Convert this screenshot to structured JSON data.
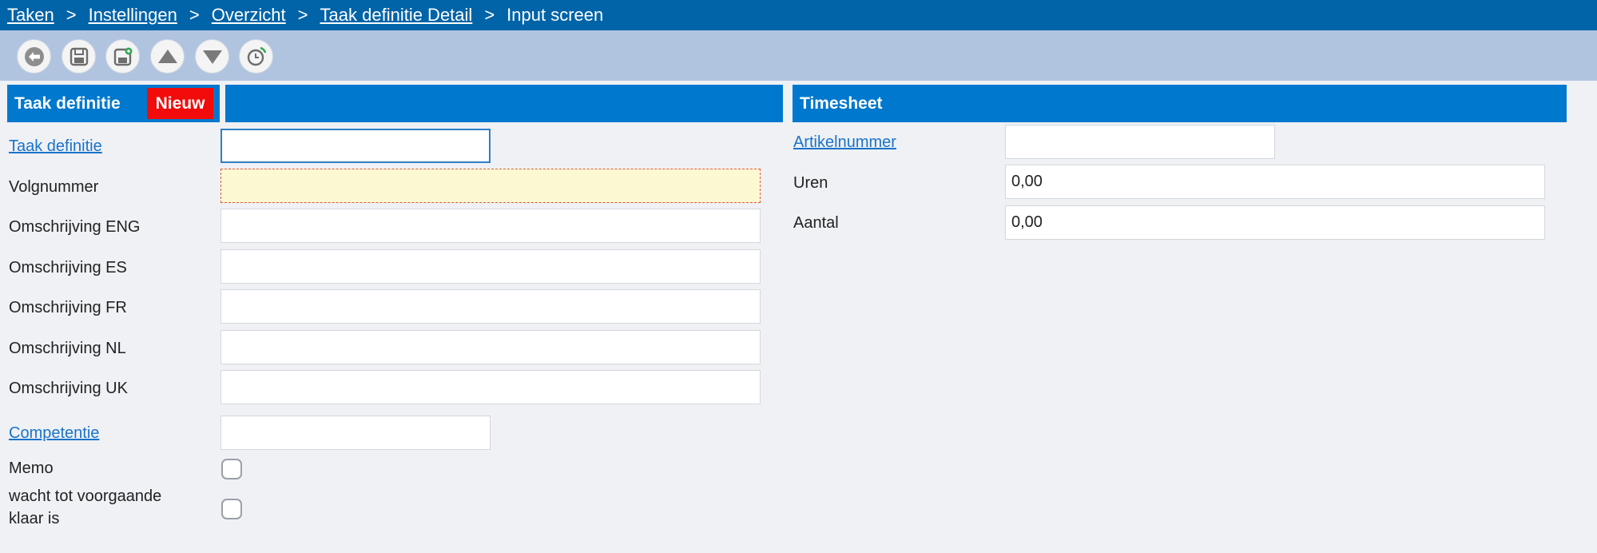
{
  "breadcrumb": {
    "items": [
      "Taken",
      "Instellingen",
      "Overzicht",
      "Taak definitie Detail"
    ],
    "current": "Input screen",
    "separator": ">"
  },
  "toolbar": {
    "buttons": [
      "back-arrow-icon",
      "save-icon",
      "save-new-icon",
      "up-arrow-icon",
      "down-arrow-icon",
      "timer-icon"
    ]
  },
  "left_panel": {
    "title": "Taak definitie",
    "badge": "Nieuw",
    "fields": {
      "taak_definitie": {
        "label": "Taak definitie",
        "value": ""
      },
      "volgnummer": {
        "label": "Volgnummer",
        "value": ""
      },
      "omschrijving_eng": {
        "label": "Omschrijving ENG",
        "value": ""
      },
      "omschrijving_es": {
        "label": "Omschrijving ES",
        "value": ""
      },
      "omschrijving_fr": {
        "label": "Omschrijving FR",
        "value": ""
      },
      "omschrijving_nl": {
        "label": "Omschrijving NL",
        "value": ""
      },
      "omschrijving_uk": {
        "label": "Omschrijving UK",
        "value": ""
      },
      "competentie": {
        "label": "Competentie",
        "value": ""
      },
      "memo": {
        "label": "Memo",
        "checked": false
      },
      "wacht": {
        "label_line1": "wacht tot voorgaande",
        "label_line2": "klaar is",
        "checked": false
      }
    }
  },
  "right_panel": {
    "title": "Timesheet",
    "fields": {
      "artikelnummer": {
        "label": "Artikelnummer",
        "value": ""
      },
      "uren": {
        "label": "Uren",
        "value": "0,00"
      },
      "aantal": {
        "label": "Aantal",
        "value": "0,00"
      }
    }
  },
  "colors": {
    "breadcrumb_bg": "#0164a8",
    "toolbar_bg": "#b0c4e0",
    "header_bg": "#0078ce",
    "badge_bg": "#f20b0b",
    "link": "#1a73c9",
    "required_bg": "#fbf8d2"
  }
}
